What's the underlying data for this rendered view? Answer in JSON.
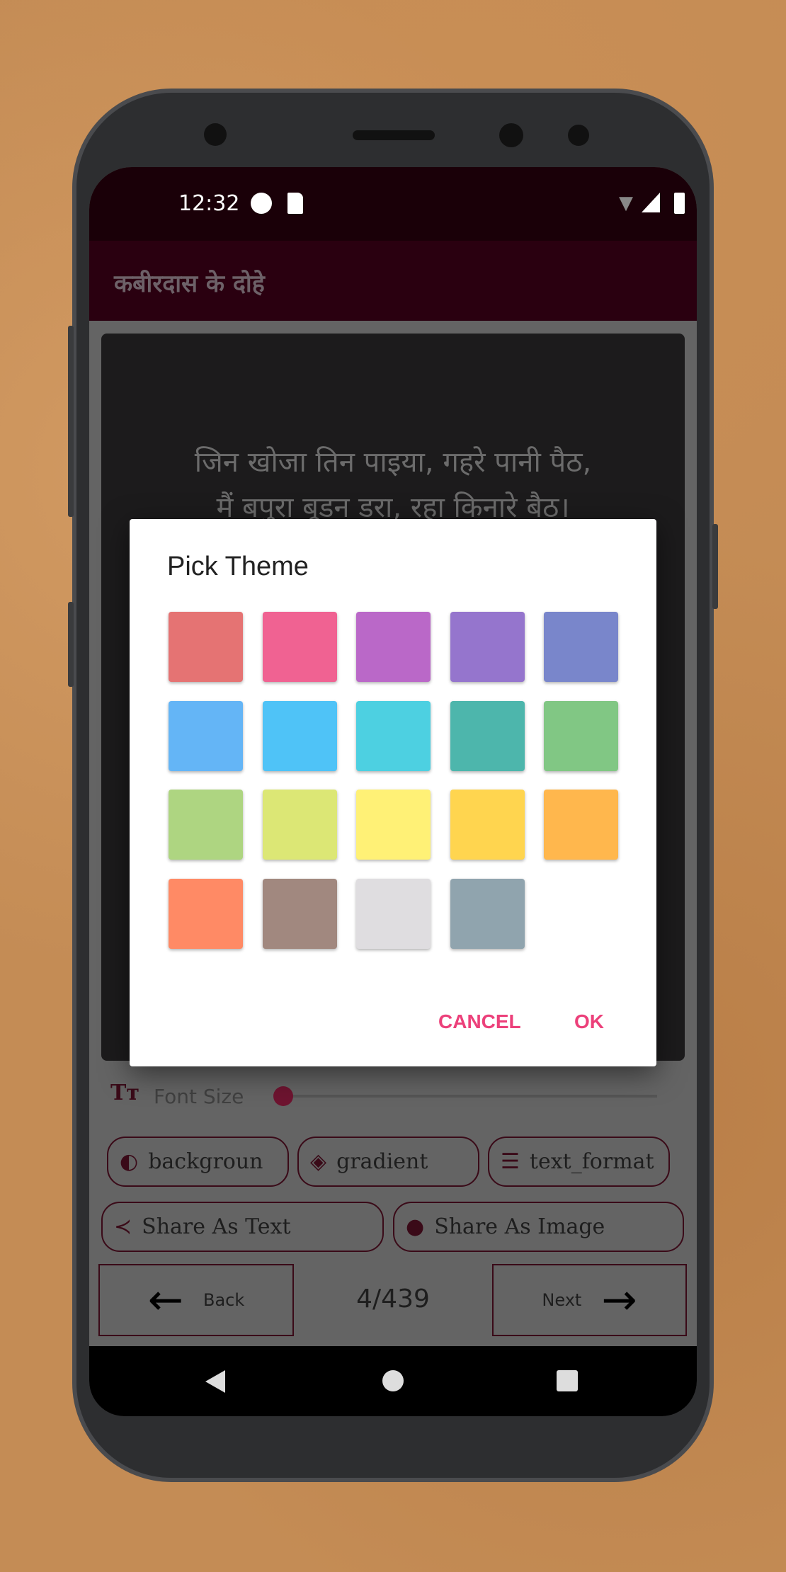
{
  "status_bar": {
    "time": "12:32"
  },
  "app_bar": {
    "title": "कबीरदास के दोहे"
  },
  "card": {
    "line1": "जिन खोजा तिन पाइया, गहरे पानी पैठ,",
    "line2": "मैं बपुरा बूडन डरा, रहा किनारे बैठ।"
  },
  "dialog": {
    "title": "Pick Theme",
    "cancel": "CANCEL",
    "ok": "OK",
    "colors": [
      "#e57373",
      "#f06292",
      "#ba68c8",
      "#9575cd",
      "#7986cb",
      "#64b5f6",
      "#4fc3f7",
      "#4dd0e1",
      "#4db6ac",
      "#81c784",
      "#aed581",
      "#dce775",
      "#fff176",
      "#ffd54f",
      "#ffb74d",
      "#ff8a65",
      "#a1887f",
      "#dfdde0",
      "#90a4ae"
    ]
  },
  "font_size": {
    "label": "Font Size",
    "value_percent": 0
  },
  "chips": [
    {
      "label": "backgroun",
      "icon": "drop-icon"
    },
    {
      "label": "gradient",
      "icon": "paint-bucket-icon"
    },
    {
      "label": "text_format",
      "icon": "align-center-icon"
    }
  ],
  "share": {
    "text": "Share As Text",
    "image": "Share As Image"
  },
  "nav": {
    "back": "Back",
    "next": "Next",
    "counter": "4/439"
  },
  "accent": "#ec407a"
}
